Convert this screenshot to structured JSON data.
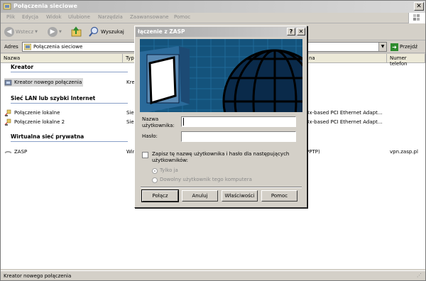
{
  "window": {
    "title": "Połączenia sieciowe"
  },
  "menu": [
    "Plik",
    "Edycja",
    "Widok",
    "Ulubione",
    "Narzędzia",
    "Zaawansowane",
    "Pomoc"
  ],
  "toolbar": {
    "back": "Wstecz",
    "search": "Wyszukaj"
  },
  "address": {
    "label": "Adres",
    "value": "Połączenia sieciowe",
    "go": "Przejdź"
  },
  "columns": {
    "name": "Nazwa",
    "type": "Typ",
    "device": "na",
    "phone": "Numer telefon"
  },
  "groups": {
    "wizard": "Kreator",
    "lan": "Sieć LAN lub szybki Internet",
    "vpn": "Wirtualna sieć prywatna"
  },
  "items": {
    "wizard": {
      "name": "Kreator nowego połączenia",
      "type": "Kre"
    },
    "lan1": {
      "name": "Połączenie lokalne",
      "type": "Sie",
      "device": "3x-based PCI Ethernet Adapt..."
    },
    "lan2": {
      "name": "Połączenie lokalne 2",
      "type": "Sie",
      "device": "3x-based PCI Ethernet Adapt..."
    },
    "vpn": {
      "name": "ZASP",
      "type": "Wir",
      "device": "PPTP)",
      "phone": "vpn.zasp.pl"
    }
  },
  "status": "Kreator nowego połączenia",
  "dialog": {
    "title": "łączenie z ZASP",
    "help_btn": "?",
    "close_btn": "✕",
    "username_label_1": "Nazwa",
    "username_label_2": "użytkownika:",
    "username_value": "",
    "password_label": "Hasło:",
    "password_value": "",
    "save_label": "Zapisz tę nazwę użytkownika i hasło dla następujących użytkowników:",
    "radio_me": "Tylko ja",
    "radio_anyone": "Dowolny użytkownik tego komputera",
    "buttons": {
      "connect": "Połącz",
      "cancel": "Anuluj",
      "properties": "Właściwości",
      "help": "Pomoc"
    }
  },
  "colors": {
    "banner": "#14537c",
    "title_gradient": "#b8b8b8"
  }
}
